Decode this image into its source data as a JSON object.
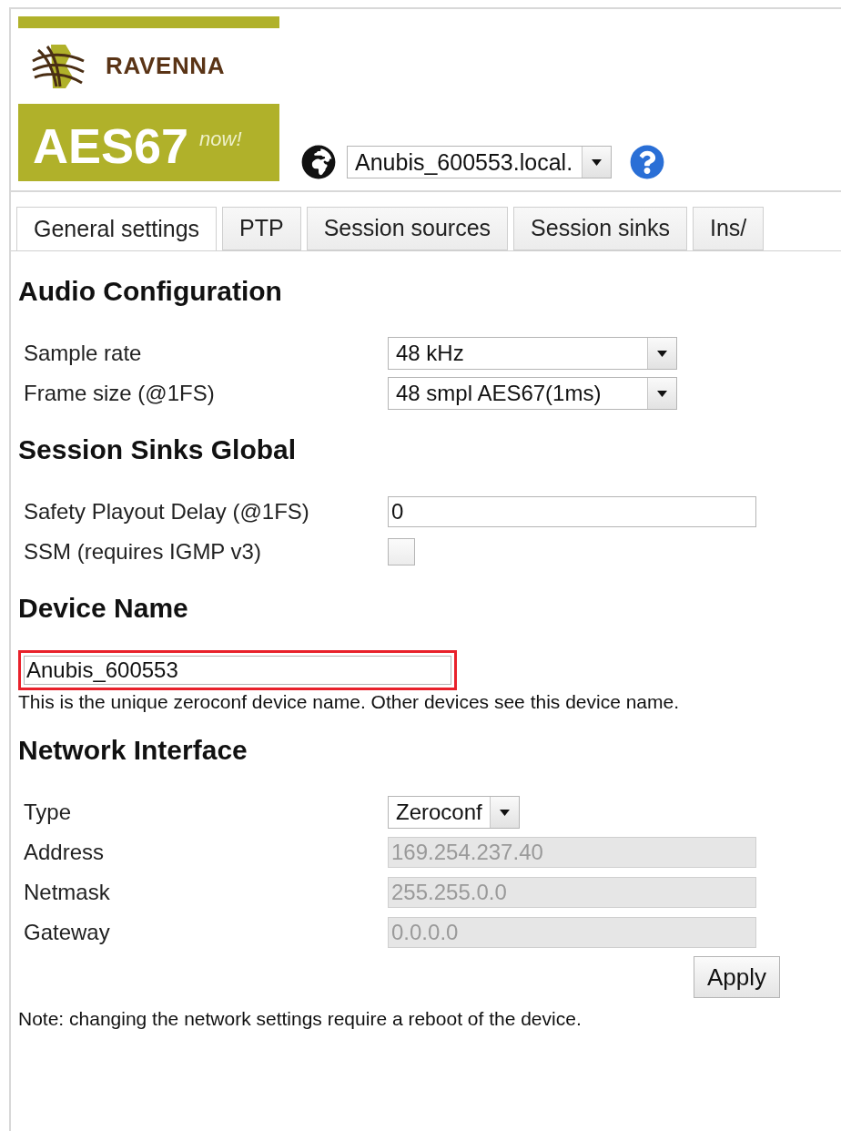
{
  "logo": {
    "brand": "RAVENNA",
    "title": "AES67",
    "tagline": "now!"
  },
  "host_select": {
    "value": "Anubis_600553.local."
  },
  "tabs": [
    {
      "label": "General settings",
      "selected": true
    },
    {
      "label": "PTP",
      "selected": false
    },
    {
      "label": "Session sources",
      "selected": false
    },
    {
      "label": "Session sinks",
      "selected": false
    },
    {
      "label": "Ins/",
      "selected": false
    }
  ],
  "sections": [
    {
      "title": "Audio Configuration",
      "rows": [
        {
          "kind": "select",
          "label": "Sample rate",
          "value": "48 kHz"
        },
        {
          "kind": "select",
          "label": "Frame size (@1FS)",
          "value": "48 smpl AES67(1ms)"
        }
      ]
    },
    {
      "title": "Session Sinks Global",
      "rows": [
        {
          "kind": "input",
          "label": "Safety Playout Delay (@1FS)",
          "value": "0",
          "disabled": false
        },
        {
          "kind": "checkbox",
          "label": "SSM (requires IGMP v3)",
          "checked": false
        }
      ]
    },
    {
      "title": "Device Name",
      "field": {
        "value": "Anubis_600553",
        "highlighted": true
      },
      "note": "This is the unique zeroconf device name. Other devices see this device name."
    },
    {
      "title": "Network Interface",
      "rows": [
        {
          "kind": "select",
          "label": "Type",
          "value": "Zeroconf"
        },
        {
          "kind": "input",
          "label": "Address",
          "value": "169.254.237.40",
          "disabled": true
        },
        {
          "kind": "input",
          "label": "Netmask",
          "value": "255.255.0.0",
          "disabled": true
        },
        {
          "kind": "input",
          "label": "Gateway",
          "value": "0.0.0.0",
          "disabled": true
        }
      ],
      "button": "Apply",
      "note": "Note: changing the network settings require a reboot of the device."
    }
  ]
}
